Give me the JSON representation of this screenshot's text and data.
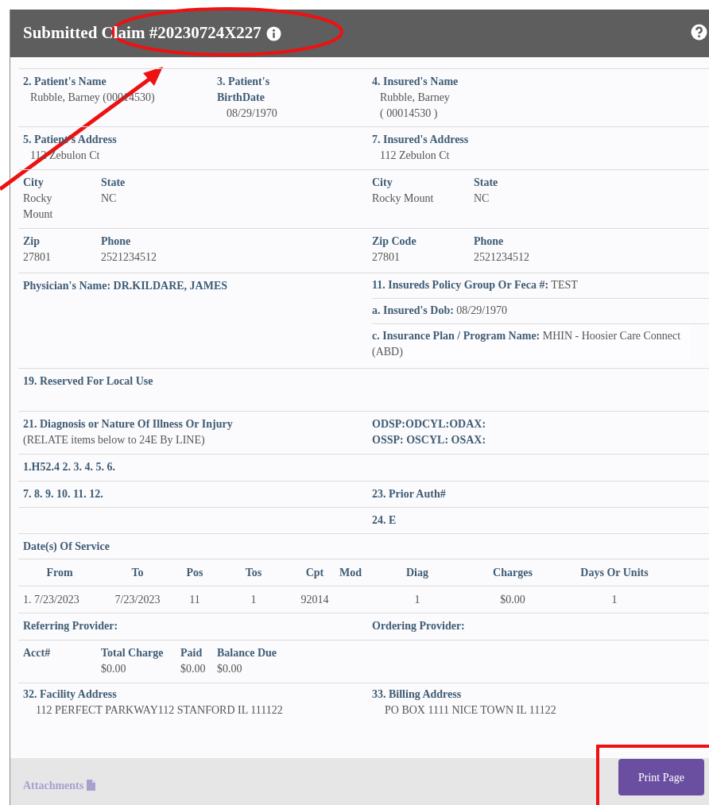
{
  "title": "Submitted Claim #20230724X227",
  "patient_name": {
    "label": "2. Patient's Name",
    "value": "Rubble, Barney (00014530)"
  },
  "patient_birthdate": {
    "label": "3. Patient's BirthDate",
    "value": "08/29/1970"
  },
  "insured_name": {
    "label": "4. Insured's Name",
    "lines": [
      "Rubble, Barney",
      "( 00014530 )"
    ]
  },
  "patient_address": {
    "label": "5. Patient's Address",
    "value": "112 Zebulon Ct"
  },
  "insured_address": {
    "label": "7. Insured's Address",
    "value": "112 Zebulon Ct"
  },
  "patient_city": {
    "label": "City",
    "value": "Rocky Mount"
  },
  "patient_state": {
    "label": "State",
    "value": "NC"
  },
  "insured_city": {
    "label": "City",
    "value": "Rocky Mount"
  },
  "insured_state": {
    "label": "State",
    "value": "NC"
  },
  "patient_zip": {
    "label": "Zip",
    "value": "27801"
  },
  "patient_phone": {
    "label": "Phone",
    "value": "2521234512"
  },
  "insured_zip": {
    "label": "Zip Code",
    "value": "27801"
  },
  "insured_phone": {
    "label": "Phone",
    "value": "2521234512"
  },
  "physician": "Physician's Name: DR.KILDARE, JAMES",
  "policy_group": {
    "label": "11. Insureds Policy Group Or Feca #:",
    "value": "TEST"
  },
  "insured_dob": {
    "label": "a. Insured's Dob:",
    "value": "08/29/1970"
  },
  "insurance_plan": {
    "label": "c. Insurance Plan / Program Name:",
    "value": "MHIN - Hoosier Care Connect (ABD)"
  },
  "reserved": "19. Reserved For Local Use",
  "diagnosis": {
    "label": "21. Diagnosis or Nature Of Illness Or Injury",
    "note": "(RELATE items below to 24E By LINE)"
  },
  "eye_od": "ODSP:ODCYL:ODAX:",
  "eye_os": "OSSP: OSCYL: OSAX:",
  "diagnosis_codes_1": "1.H52.4 2. 3. 4. 5. 6.",
  "diagnosis_codes_2": "7. 8. 9. 10. 11. 12.",
  "prior_auth": "23. Prior Auth#",
  "line_24e": "24. E",
  "service": {
    "title": "Date(s) Of Service",
    "columns": [
      "From",
      "To",
      "Pos",
      "Tos",
      "Cpt",
      "Mod",
      "Diag",
      "Charges",
      "Days Or Units"
    ],
    "rows": [
      [
        "1. 7/23/2023",
        "7/23/2023",
        "11",
        "1",
        "92014",
        null,
        "1",
        "$0.00",
        "1"
      ]
    ]
  },
  "referring_provider": "Referring Provider:",
  "ordering_provider": "Ordering Provider:",
  "totals": {
    "acct_label": "Acct#",
    "total_label": "Total Charge",
    "total": "$0.00",
    "paid_label": "Paid",
    "paid": "$0.00",
    "balance_label": "Balance Due",
    "balance": "$0.00"
  },
  "facility": {
    "label": "32. Facility Address",
    "value": "112 PERFECT PARKWAY112 STANFORD IL 111122"
  },
  "billing": {
    "label": "33. Billing Address",
    "value": "PO BOX 1111 NICE TOWN IL 11122"
  },
  "footer": {
    "attachments": "Attachments",
    "print": "Print Page"
  }
}
